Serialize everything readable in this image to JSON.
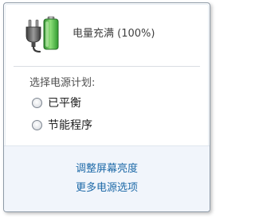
{
  "status": {
    "battery_icon": "battery-plug-icon",
    "text": "电量充满 (100%)"
  },
  "plans": {
    "heading": "选择电源计划:",
    "options": [
      {
        "label": "已平衡",
        "selected": false
      },
      {
        "label": "节能程序",
        "selected": false
      }
    ]
  },
  "links": {
    "adjust_brightness": "调整屏幕亮度",
    "more_options": "更多电源选项"
  },
  "colors": {
    "link": "#1e6aa8",
    "footer_background": "#f1f5fb",
    "battery_green": "#3fb43f"
  }
}
